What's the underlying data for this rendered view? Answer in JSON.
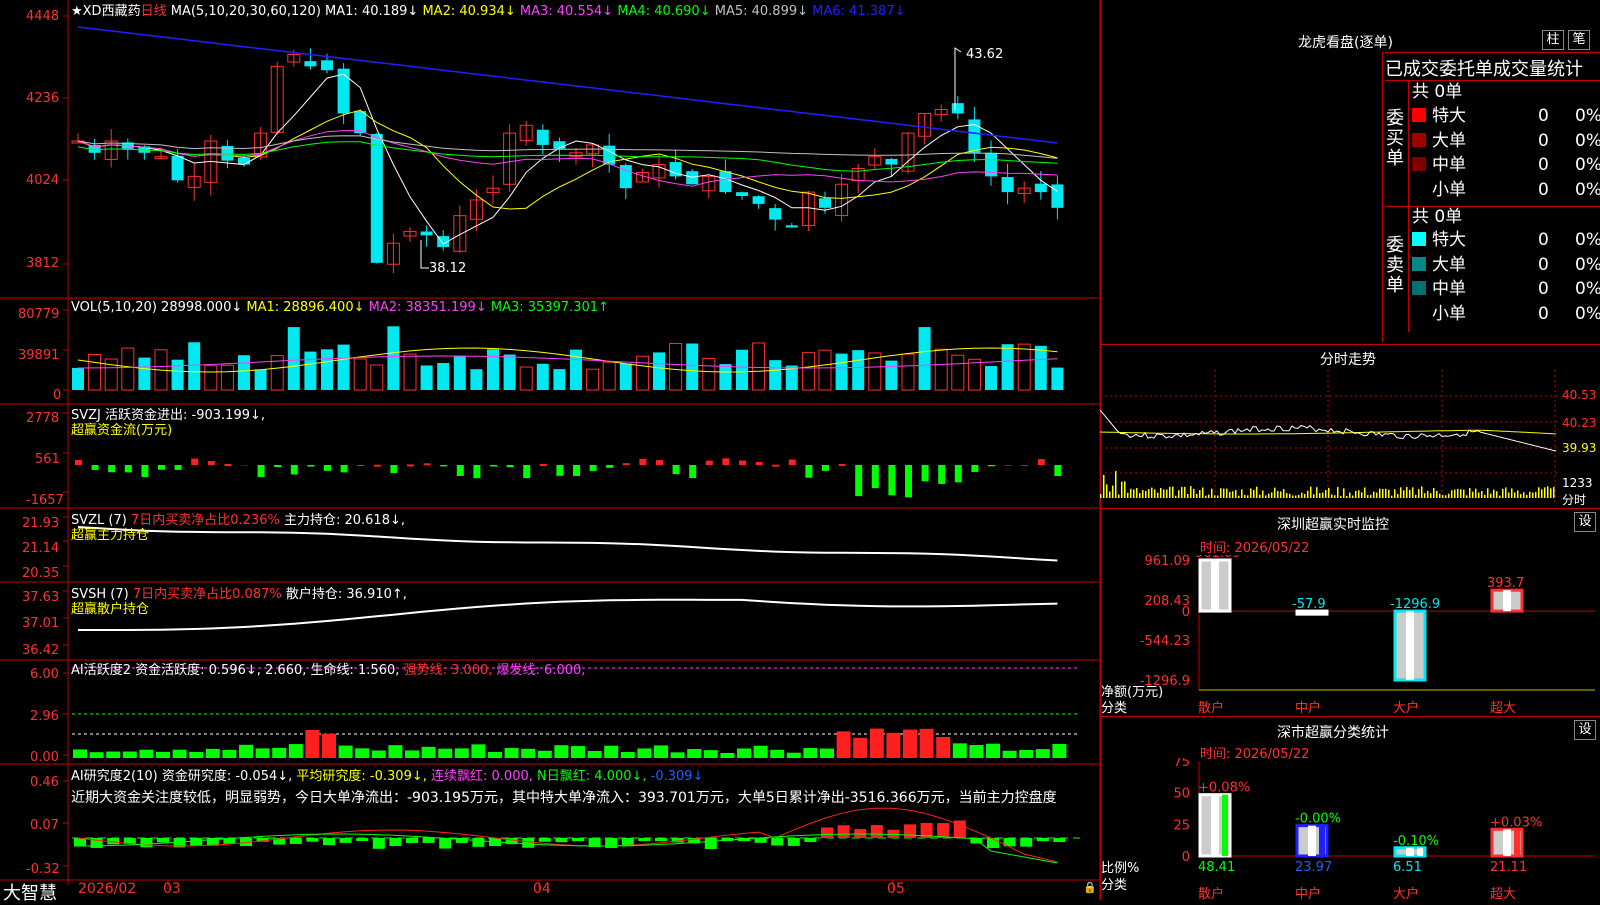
{
  "app": {
    "name": "大智慧",
    "stock_title": "★XD西藏药",
    "period": "日线"
  },
  "colors": {
    "up": "#ff3030",
    "down": "#00e8f0",
    "background": "#000000",
    "grid": "#c00000",
    "ma5": "#ffffff",
    "ma10": "#ffff00",
    "ma20": "#ff40ff",
    "ma30": "#00ff00",
    "ma60": "#c0c0c0",
    "ma120": "#2020ff"
  },
  "price_panel": {
    "header": {
      "ma_label": "MA(5,10,20,30,60,120)",
      "ma1": "MA1: 40.189↓",
      "ma2": "MA2: 40.934↓",
      "ma3": "MA3: 40.554↓",
      "ma4": "MA4: 40.690↓",
      "ma5": "MA5: 40.899↓",
      "ma6": "MA6: 41.387↓"
    },
    "y_ticks": [
      "4448",
      "4236",
      "4024",
      "3812"
    ],
    "high_label": "43.62",
    "low_label": "38.12"
  },
  "vol_panel": {
    "header": {
      "label": "VOL(5,10,20)",
      "value": "28998.000↓",
      "ma1": "MA1: 28896.400↓",
      "ma2": "MA2: 38351.199↓",
      "ma3": "MA3: 35397.301↑"
    },
    "y_ticks": [
      "80779",
      "39891",
      "0"
    ]
  },
  "svzj_panel": {
    "header": {
      "label": "SVZJ",
      "text": "活跃资金进出: -903.199↓,",
      "subtitle": "超赢资金流(万元)"
    },
    "y_ticks": [
      "2778",
      "561",
      "-1657"
    ]
  },
  "svzl_panel": {
    "header": {
      "label": "SVZL (7)",
      "ratio": "7日内买卖净占比0.236%",
      "text": "主力持仓: 20.618↓,",
      "subtitle": "超赢主力持仓"
    },
    "y_ticks": [
      "21.93",
      "21.14",
      "20.35"
    ]
  },
  "svsh_panel": {
    "header": {
      "label": "SVSH (7)",
      "ratio": "7日内买卖净占比0.087%",
      "text": "散户持仓: 36.910↑,",
      "subtitle": "超赢散户持仓"
    },
    "y_ticks": [
      "37.63",
      "37.01",
      "36.42"
    ]
  },
  "ai_panel": {
    "header": {
      "label": "AI活跃度2",
      "text": "资金活跃度: 0.596↓, 2.660, 生命线: 1.560,",
      "strong": "强势线: 3.000,",
      "burst": "爆发线: 6.000,"
    },
    "y_ticks": [
      "6.00",
      "2.96",
      "0.00"
    ]
  },
  "research_panel": {
    "header": {
      "label": "AI研究度2(10)",
      "text": "资金研究度: -0.054↓,",
      "avg": "平均研究度: -0.309↓,",
      "lianxu": "连续飘红: 0.000,",
      "nday": "N日飘红: 4.000↓,",
      "last": "-0.309↓"
    },
    "comment": "近期大资金关注度较低，明显弱势，今日大单净流出：-903.195万元，其中特大单净流入：393.701万元，大单5日累计净出-3516.366万元，当前主力控盘度",
    "y_ticks": [
      "0.46",
      "0.07",
      "-0.32"
    ]
  },
  "x_axis": {
    "labels": [
      "2026/02",
      "03",
      "04",
      "05"
    ]
  },
  "right": {
    "lhb_title": "龙虎看盘(逐单)",
    "btn_zhu": "柱",
    "btn_bi": "笔",
    "stats_title": "已成交委托单成交量统计",
    "buy": {
      "side_label": "委买单",
      "total": "共 0单",
      "rows": [
        {
          "name": "特大",
          "count": "0",
          "pct": "0%"
        },
        {
          "name": "大单",
          "count": "0",
          "pct": "0%"
        },
        {
          "name": "中单",
          "count": "0",
          "pct": "0%"
        },
        {
          "name": "小单",
          "count": "0",
          "pct": "0%"
        }
      ]
    },
    "sell": {
      "side_label": "委卖单",
      "total": "共 0单",
      "rows": [
        {
          "name": "特大",
          "count": "0",
          "pct": "0%"
        },
        {
          "name": "大单",
          "count": "0",
          "pct": "0%"
        },
        {
          "name": "中单",
          "count": "0",
          "pct": "0%"
        },
        {
          "name": "小单",
          "count": "0",
          "pct": "0%"
        }
      ]
    },
    "intraday_title": "分时走势",
    "intraday_y": [
      "40.53",
      "40.23",
      "39.93",
      "1233",
      "分时"
    ],
    "sz_title": "深圳超赢实时监控",
    "sz_btn": "设",
    "sz_time": "时间: 2026/05/22",
    "sz_y": [
      "961.09",
      "208.43",
      "0",
      "-544.23",
      "-1296.9"
    ],
    "sz_unit_1": "净额(万元)",
    "sz_unit_2": "分类",
    "sz_bar_labels": [
      "961.09",
      "-57.9",
      "-1296.9",
      "393.7"
    ],
    "sz_categories": [
      "散户",
      "中户",
      "大户",
      "超大"
    ],
    "cls_title": "深市超赢分类统计",
    "cls_btn": "设",
    "cls_time": "时间: 2026/05/22",
    "cls_y": [
      "75",
      "50",
      "25",
      "0"
    ],
    "cls_unit_1": "比例%",
    "cls_unit_2": "分类",
    "cls_top_labels": [
      "+0.08%",
      "-0.00%",
      "-0.10%",
      "+0.03%"
    ],
    "cls_bottom_labels": [
      "48.41",
      "23.97",
      "6.51",
      "21.11"
    ],
    "cls_categories": [
      "散户",
      "中户",
      "大户",
      "超大"
    ]
  },
  "chart_data": [
    {
      "type": "bar",
      "title": "深圳超赢实时监控",
      "ylabel": "净额(万元)",
      "xlabel": "分类",
      "categories": [
        "散户",
        "中户",
        "大户",
        "超大"
      ],
      "values": [
        961.09,
        -57.9,
        -1296.9,
        393.7
      ],
      "ylim": [
        -1296.9,
        961.09
      ]
    },
    {
      "type": "bar",
      "title": "深市超赢分类统计",
      "ylabel": "比例%",
      "xlabel": "分类",
      "categories": [
        "散户",
        "中户",
        "大户",
        "超大"
      ],
      "values": [
        48.41,
        23.97,
        6.51,
        21.11
      ],
      "changes": [
        "+0.08%",
        "-0.00%",
        "-0.10%",
        "+0.03%"
      ],
      "ylim": [
        0,
        75
      ]
    }
  ]
}
